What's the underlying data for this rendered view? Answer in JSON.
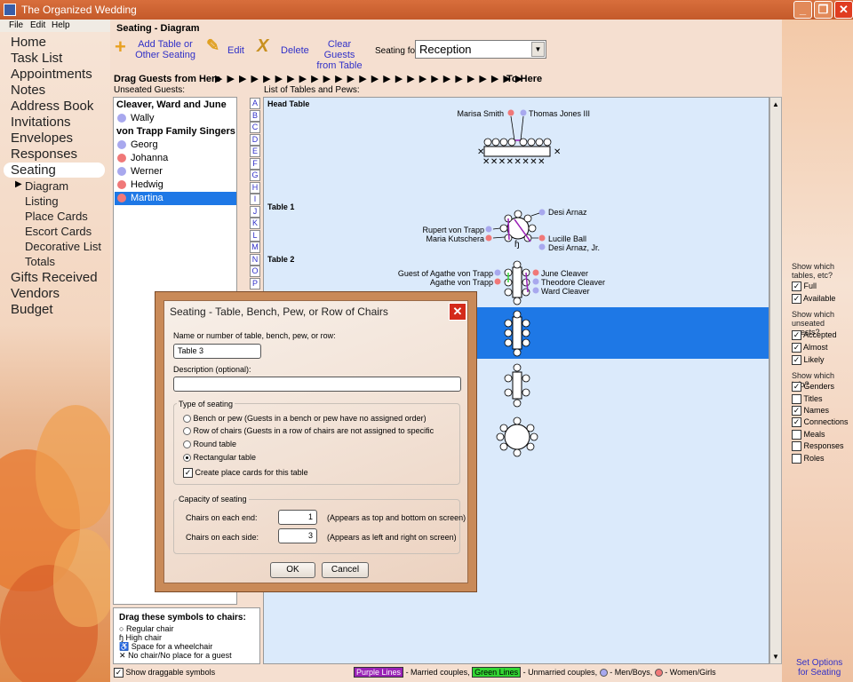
{
  "window": {
    "title": "The Organized Wedding",
    "controls": {
      "minimize": "_",
      "maximize": "❐",
      "close": "✕"
    }
  },
  "menu": [
    "File",
    "Edit",
    "Help"
  ],
  "nav": {
    "items": [
      "Home",
      "Task List",
      "Appointments",
      "Notes",
      "Address Book",
      "Invitations",
      "Envelopes",
      "Responses",
      "Seating"
    ],
    "seating_sub": [
      "Diagram",
      "Listing",
      "Place Cards",
      "Escort Cards",
      "Decorative List",
      "Totals"
    ],
    "items_after": [
      "Gifts Received",
      "Vendors",
      "Budget"
    ],
    "active": "Seating",
    "active_sub": "Diagram"
  },
  "toolbar": {
    "title": "Seating - Diagram",
    "add_label_1": "Add Table or",
    "add_label_2": "Other Seating",
    "edit_label": "Edit",
    "delete_label": "Delete",
    "clear_label_1": "Clear Guests",
    "clear_label_2": "from Table",
    "seating_for_label": "Seating for:",
    "seating_for_value": "Reception"
  },
  "drag": {
    "from": "Drag Guests from Here",
    "arrows": "▶ ▶ ▶ ▶ ▶ ▶ ▶ ▶ ▶ ▶ ▶ ▶ ▶ ▶ ▶ ▶ ▶ ▶ ▶ ▶ ▶ ▶ ▶ ▶ ▶ ▶",
    "to": "To Here"
  },
  "unseated_label": "Unseated Guests:",
  "tables_label": "List of Tables and Pews:",
  "guests": {
    "group1": "Cleaver, Ward and June",
    "g1": [
      {
        "name": "Wally",
        "color": "blue"
      }
    ],
    "group2": "von Trapp Family Singers",
    "g2": [
      {
        "name": "Georg",
        "color": "blue"
      },
      {
        "name": "Johanna",
        "color": "pink"
      },
      {
        "name": "Werner",
        "color": "blue"
      },
      {
        "name": "Hedwig",
        "color": "pink"
      },
      {
        "name": "Martina",
        "color": "pink",
        "selected": true
      }
    ]
  },
  "letters": [
    "A",
    "B",
    "C",
    "D",
    "E",
    "F",
    "G",
    "H",
    "I",
    "J",
    "K",
    "L",
    "M",
    "N",
    "O",
    "P"
  ],
  "tables": {
    "head": {
      "label": "Head Table",
      "left_guest": "Marisa Smith",
      "right_guest": "Thomas Jones III"
    },
    "t1": {
      "label": "Table 1",
      "guests": [
        "Desi Arnaz",
        "Rupert von Trapp",
        "Maria Kutschera",
        "Lucille Ball",
        "Desi Arnaz, Jr."
      ]
    },
    "t2": {
      "label": "Table 2",
      "guests": [
        "Guest of Agathe von Trapp",
        "Agathe von Trapp",
        "June Cleaver",
        "Theodore Cleaver",
        "Ward Cleaver"
      ]
    }
  },
  "symbols": {
    "title": "Drag these symbols to chairs:",
    "items": [
      {
        "glyph": "○",
        "label": "Regular chair"
      },
      {
        "glyph": "ɧ",
        "label": "High chair"
      },
      {
        "glyph": "♿",
        "label": "Space for a wheelchair"
      },
      {
        "glyph": "✕",
        "label": "No chair/No place for a guest"
      }
    ]
  },
  "footer": {
    "show_draggable": "Show draggable symbols",
    "purple": "Purple Lines",
    "married": "- Married couples,",
    "green": "Green Lines",
    "unmarried": "- Unmarried couples,",
    "men": "- Men/Boys,",
    "women": "- Women/Girls"
  },
  "options": {
    "tables_heading": "Show which tables, etc?",
    "tables": [
      {
        "label": "Full",
        "checked": true
      },
      {
        "label": "Available",
        "checked": true
      }
    ],
    "guests_heading": "Show which unseated guests?",
    "guests": [
      {
        "label": "Accepted",
        "checked": true
      },
      {
        "label": "Almost",
        "checked": true
      },
      {
        "label": "Likely",
        "checked": true
      }
    ],
    "info_heading": "Show which info?",
    "info": [
      {
        "label": "Genders",
        "checked": true
      },
      {
        "label": "Titles",
        "checked": false
      },
      {
        "label": "Names",
        "checked": true
      },
      {
        "label": "Connections",
        "checked": true
      },
      {
        "label": "Meals",
        "checked": false
      },
      {
        "label": "Responses",
        "checked": false
      },
      {
        "label": "Roles",
        "checked": false
      }
    ],
    "set_options_1": "Set Options",
    "set_options_2": "for Seating"
  },
  "dialog": {
    "title": "Seating - Table, Bench, Pew, or Row of Chairs",
    "name_label": "Name or number of table, bench, pew, or row:",
    "name_value": "Table 3",
    "desc_label": "Description (optional):",
    "desc_value": "",
    "type_heading": "Type of seating",
    "types": [
      {
        "label": "Bench or pew (Guests in a bench or pew have no assigned order)",
        "selected": false
      },
      {
        "label": "Row of chairs (Guests in a row of chairs are not assigned to specific",
        "selected": false
      },
      {
        "label": "Round table",
        "selected": false
      },
      {
        "label": "Rectangular table",
        "selected": true
      }
    ],
    "place_cards_label": "Create place cards for this table",
    "place_cards_checked": true,
    "capacity_heading": "Capacity of seating",
    "ends_label": "Chairs on each end:",
    "ends_value": "1",
    "ends_note": "(Appears as top and bottom on screen)",
    "sides_label": "Chairs on each side:",
    "sides_value": "3",
    "sides_note": "(Appears as left and right on screen)",
    "ok_label": "OK",
    "cancel_label": "Cancel"
  },
  "colors": {
    "selection": "#1e78e6",
    "link": "#3030c8",
    "men": "#a8a8ee",
    "women": "#f07878",
    "married": "#9a22b6",
    "unmarried": "#33d633"
  }
}
